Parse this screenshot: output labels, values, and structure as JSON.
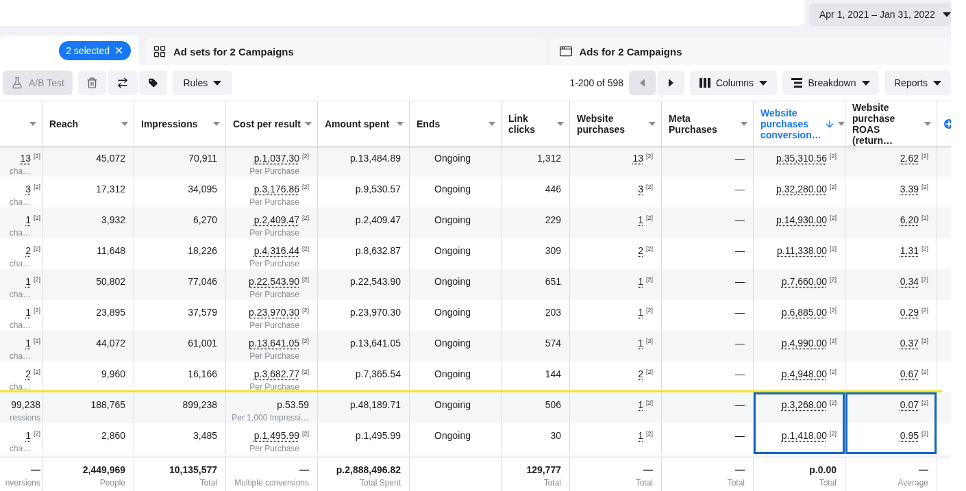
{
  "date_range": "Apr 1, 2021 – Jan 31, 2022",
  "tabs": [
    {
      "kind": "campaigns",
      "chip": "2 selected",
      "selected": true
    },
    {
      "kind": "adsets",
      "label": "Ad sets for 2 Campaigns",
      "selected": false
    },
    {
      "kind": "ads",
      "label": "Ads for 2 Campaigns",
      "selected": false
    }
  ],
  "toolbar": {
    "ab_test": {
      "label": "A/B Test",
      "disabled": true
    },
    "rules": "Rules",
    "pagination": "1-200 of 598",
    "prev_disabled": true,
    "columns": "Columns",
    "breakdown": "Breakdown",
    "reports": "Reports"
  },
  "table": {
    "columns": [
      {
        "kind": "clipped",
        "sorted": false
      },
      {
        "label": "Reach",
        "sorted": false
      },
      {
        "label": "Impressions",
        "sorted": false
      },
      {
        "label": "Cost per result",
        "sorted": false
      },
      {
        "label": "Amount spent",
        "sorted": false
      },
      {
        "label": "Ends",
        "kind": "text",
        "sorted": false
      },
      {
        "label": "Link clicks",
        "sorted": false
      },
      {
        "label": "Website purchases",
        "sorted": false
      },
      {
        "label": "Meta Purchases",
        "sorted": false
      },
      {
        "label": "Website purchases conversion…",
        "sorted": true
      },
      {
        "label": "Website purchase ROAS (return…",
        "sorted": false
      }
    ],
    "rows": [
      {
        "line_below": false,
        "cells": [
          {
            "value": "13",
            "note": "[2]",
            "caption": "cha…",
            "boxed": false
          },
          {
            "value": "45,072",
            "boxed": false
          },
          {
            "value": "70,911",
            "boxed": false
          },
          {
            "value": "p.1,037.30",
            "note": "[2]",
            "caption": "Per Purchase",
            "boxed": false
          },
          {
            "value": "p.13,484.89",
            "boxed": false
          },
          {
            "value": "Ongoing",
            "boxed": false
          },
          {
            "value": "1,312",
            "boxed": false
          },
          {
            "value": "13",
            "note": "[2]",
            "boxed": false
          },
          {
            "value": "—",
            "boxed": false
          },
          {
            "value": "p.35,310.56",
            "note": "[2]",
            "boxed": false
          },
          {
            "value": "2.62",
            "note": "[2]",
            "boxed": false
          }
        ]
      },
      {
        "line_below": false,
        "cells": [
          {
            "value": "3",
            "note": "[2]",
            "caption": "cha…",
            "boxed": false
          },
          {
            "value": "17,312",
            "boxed": false
          },
          {
            "value": "34,095",
            "boxed": false
          },
          {
            "value": "p.3,176.86",
            "note": "[2]",
            "caption": "Per Purchase",
            "boxed": false
          },
          {
            "value": "p.9,530.57",
            "boxed": false
          },
          {
            "value": "Ongoing",
            "boxed": false
          },
          {
            "value": "446",
            "boxed": false
          },
          {
            "value": "3",
            "note": "[2]",
            "boxed": false
          },
          {
            "value": "—",
            "boxed": false
          },
          {
            "value": "p.32,280.00",
            "note": "[2]",
            "boxed": false
          },
          {
            "value": "3.39",
            "note": "[2]",
            "boxed": false
          }
        ]
      },
      {
        "line_below": false,
        "cells": [
          {
            "value": "1",
            "note": "[2]",
            "caption": "cha…",
            "boxed": false
          },
          {
            "value": "3,932",
            "boxed": false
          },
          {
            "value": "6,270",
            "boxed": false
          },
          {
            "value": "p.2,409.47",
            "note": "[2]",
            "caption": "Per Purchase",
            "boxed": false
          },
          {
            "value": "p.2,409.47",
            "boxed": false
          },
          {
            "value": "Ongoing",
            "boxed": false
          },
          {
            "value": "229",
            "boxed": false
          },
          {
            "value": "1",
            "note": "[2]",
            "boxed": false
          },
          {
            "value": "—",
            "boxed": false
          },
          {
            "value": "p.14,930.00",
            "note": "[2]",
            "boxed": false
          },
          {
            "value": "6.20",
            "note": "[2]",
            "boxed": false
          }
        ]
      },
      {
        "line_below": false,
        "cells": [
          {
            "value": "2",
            "note": "[2]",
            "caption": "cha…",
            "boxed": false
          },
          {
            "value": "11,648",
            "boxed": false
          },
          {
            "value": "18,226",
            "boxed": false
          },
          {
            "value": "p.4,316.44",
            "note": "[2]",
            "caption": "Per Purchase",
            "boxed": false
          },
          {
            "value": "p.8,632.87",
            "boxed": false
          },
          {
            "value": "Ongoing",
            "boxed": false
          },
          {
            "value": "309",
            "boxed": false
          },
          {
            "value": "2",
            "note": "[2]",
            "boxed": false
          },
          {
            "value": "—",
            "boxed": false
          },
          {
            "value": "p.11,338.00",
            "note": "[2]",
            "boxed": false
          },
          {
            "value": "1.31",
            "note": "[2]",
            "boxed": false
          }
        ]
      },
      {
        "line_below": false,
        "cells": [
          {
            "value": "1",
            "note": "[2]",
            "caption": "cha…",
            "boxed": false
          },
          {
            "value": "50,802",
            "boxed": false
          },
          {
            "value": "77,046",
            "boxed": false
          },
          {
            "value": "p.22,543.90",
            "note": "[2]",
            "caption": "Per Purchase",
            "boxed": false
          },
          {
            "value": "p.22,543.90",
            "boxed": false
          },
          {
            "value": "Ongoing",
            "boxed": false
          },
          {
            "value": "651",
            "boxed": false
          },
          {
            "value": "1",
            "note": "[2]",
            "boxed": false
          },
          {
            "value": "—",
            "boxed": false
          },
          {
            "value": "p.7,660.00",
            "note": "[2]",
            "boxed": false
          },
          {
            "value": "0.34",
            "note": "[2]",
            "boxed": false
          }
        ]
      },
      {
        "line_below": false,
        "cells": [
          {
            "value": "1",
            "note": "[2]",
            "caption": "cha…",
            "boxed": false
          },
          {
            "value": "23,895",
            "boxed": false
          },
          {
            "value": "37,579",
            "boxed": false
          },
          {
            "value": "p.23,970.30",
            "note": "[2]",
            "caption": "Per Purchase",
            "boxed": false
          },
          {
            "value": "p.23,970.30",
            "boxed": false
          },
          {
            "value": "Ongoing",
            "boxed": false
          },
          {
            "value": "203",
            "boxed": false
          },
          {
            "value": "1",
            "note": "[2]",
            "boxed": false
          },
          {
            "value": "—",
            "boxed": false
          },
          {
            "value": "p.6,885.00",
            "note": "[2]",
            "boxed": false
          },
          {
            "value": "0.29",
            "note": "[2]",
            "boxed": false
          }
        ]
      },
      {
        "line_below": false,
        "cells": [
          {
            "value": "1",
            "note": "[2]",
            "caption": "cha…",
            "boxed": false
          },
          {
            "value": "44,072",
            "boxed": false
          },
          {
            "value": "61,001",
            "boxed": false
          },
          {
            "value": "p.13,641.05",
            "note": "[2]",
            "caption": "Per Purchase",
            "boxed": false
          },
          {
            "value": "p.13,641.05",
            "boxed": false
          },
          {
            "value": "Ongoing",
            "boxed": false
          },
          {
            "value": "574",
            "boxed": false
          },
          {
            "value": "1",
            "note": "[2]",
            "boxed": false
          },
          {
            "value": "—",
            "boxed": false
          },
          {
            "value": "p.4,990.00",
            "note": "[2]",
            "boxed": false
          },
          {
            "value": "0.37",
            "note": "[2]",
            "boxed": false
          }
        ]
      },
      {
        "line_below": true,
        "cells": [
          {
            "value": "2",
            "note": "[2]",
            "caption": "cha…",
            "boxed": false
          },
          {
            "value": "9,960",
            "boxed": false
          },
          {
            "value": "16,166",
            "boxed": false
          },
          {
            "value": "p.3,682.77",
            "note": "[2]",
            "caption": "Per Purchase",
            "boxed": false
          },
          {
            "value": "p.7,365.54",
            "boxed": false
          },
          {
            "value": "Ongoing",
            "boxed": false
          },
          {
            "value": "144",
            "boxed": false
          },
          {
            "value": "2",
            "note": "[2]",
            "boxed": false
          },
          {
            "value": "—",
            "boxed": false
          },
          {
            "value": "p.4,948.00",
            "note": "[2]",
            "boxed": false
          },
          {
            "value": "0.67",
            "note": "[2]",
            "boxed": false
          }
        ]
      },
      {
        "line_below": false,
        "cells": [
          {
            "value": "99,238",
            "caption": "ressions",
            "boxed": false
          },
          {
            "value": "188,765",
            "boxed": false
          },
          {
            "value": "899,238",
            "boxed": false
          },
          {
            "value": "p.53.59",
            "caption": "Per 1,000 Impressi…",
            "boxed": false
          },
          {
            "value": "p.48,189.71",
            "boxed": false
          },
          {
            "value": "Ongoing",
            "boxed": false
          },
          {
            "value": "506",
            "boxed": false
          },
          {
            "value": "1",
            "note": "[2]",
            "boxed": false
          },
          {
            "value": "—",
            "boxed": false
          },
          {
            "value": "p.3,268.00",
            "note": "[2]",
            "boxed": true
          },
          {
            "value": "0.07",
            "note": "[2]",
            "boxed": true
          }
        ]
      },
      {
        "line_below": false,
        "cells": [
          {
            "value": "1",
            "note": "[2]",
            "caption": "cha…",
            "boxed": false
          },
          {
            "value": "2,860",
            "boxed": false
          },
          {
            "value": "3,485",
            "boxed": false
          },
          {
            "value": "p.1,495.99",
            "note": "[2]",
            "caption": "Per Purchase",
            "boxed": false
          },
          {
            "value": "p.1,495.99",
            "boxed": false
          },
          {
            "value": "Ongoing",
            "boxed": false
          },
          {
            "value": "30",
            "boxed": false
          },
          {
            "value": "1",
            "note": "[2]",
            "boxed": false
          },
          {
            "value": "—",
            "boxed": false
          },
          {
            "value": "p.1,418.00",
            "note": "[2]",
            "boxed": true
          },
          {
            "value": "0.95",
            "note": "[2]",
            "boxed": true
          }
        ]
      }
    ],
    "totals": [
      {
        "value": "—",
        "caption": "nversions"
      },
      {
        "value": "2,449,969",
        "caption": "People"
      },
      {
        "value": "10,135,577",
        "caption": "Total"
      },
      {
        "value": "—",
        "caption": "Multiple conversions"
      },
      {
        "value": "p.2,888,496.82",
        "caption": "Total Spent"
      },
      {
        "value": "129,777",
        "caption": "Total"
      },
      {
        "value": "—",
        "caption": "Total"
      },
      {
        "value": "—",
        "caption": "Total"
      },
      {
        "value": "p.0.00",
        "caption": "Total"
      },
      {
        "value": "—",
        "caption": "Average"
      }
    ]
  }
}
